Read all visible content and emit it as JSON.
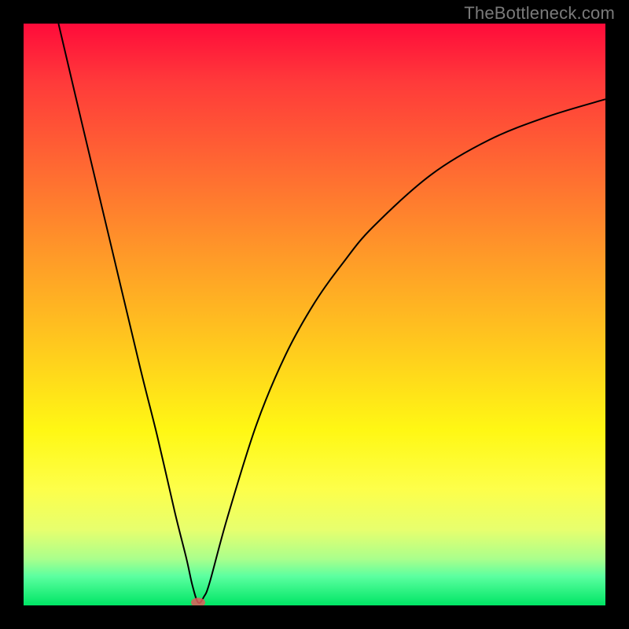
{
  "watermark": "TheBottleneck.com",
  "chart_data": {
    "type": "line",
    "title": "",
    "xlabel": "",
    "ylabel": "",
    "xlim": [
      0,
      100
    ],
    "ylim": [
      0,
      100
    ],
    "series": [
      {
        "name": "bottleneck-curve",
        "x": [
          6,
          10,
          15,
          20,
          23,
          26,
          28,
          29,
          30,
          31,
          32,
          35,
          40,
          45,
          50,
          55,
          60,
          70,
          80,
          90,
          100
        ],
        "values": [
          100,
          83,
          62,
          41,
          29,
          16,
          8,
          3.5,
          0.5,
          1.5,
          4,
          15,
          31,
          43,
          52,
          59,
          65,
          74,
          80,
          84,
          87
        ]
      }
    ],
    "marker": {
      "x": 30,
      "y": 0.5,
      "color": "#e05a5a"
    },
    "colors": {
      "frame": "#000000",
      "curve": "#000000",
      "gradient_top": "#ff0b3a",
      "gradient_bottom": "#00e565",
      "watermark": "#7a7a7a"
    }
  }
}
